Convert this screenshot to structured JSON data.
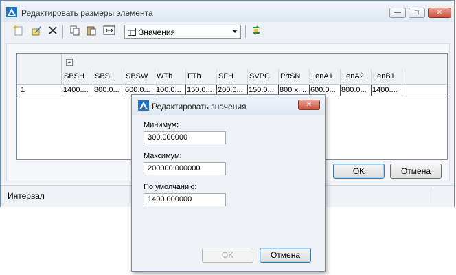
{
  "window": {
    "title": "Редактировать размеры элемента",
    "minimize_label": "—",
    "maximize_label": "□",
    "close_label": "✕"
  },
  "toolbar": {
    "combo_value": "Значения",
    "icons": [
      "new-row-icon",
      "edit-icon",
      "delete-icon",
      "copy-icon",
      "paste-icon",
      "insert-dimension-icon",
      "settings-table-icon",
      "refresh-icon"
    ]
  },
  "grid": {
    "expand_label": "+",
    "columns": [
      "SBSH",
      "SBSL",
      "SBSW",
      "WTh",
      "FTh",
      "SFH",
      "SVPC",
      "PrtSN",
      "LenA1",
      "LenA2",
      "LenB1"
    ],
    "rows": [
      {
        "num": "1",
        "cells": [
          "1400....",
          "800.0...",
          "600.0...",
          "100.0...",
          "150.0...",
          "200.0...",
          "150.0...",
          "800 x ...",
          "600.0...",
          "800.0...",
          "1400...."
        ]
      }
    ]
  },
  "buttons": {
    "ok": "OK",
    "cancel": "Отмена"
  },
  "status": {
    "text": "Интервал"
  },
  "dialog": {
    "title": "Редактировать значения",
    "close_label": "✕",
    "min_label": "Минимум:",
    "min_value": "300.000000",
    "max_label": "Максимум:",
    "max_value": "200000.000000",
    "default_label": "По умолчанию:",
    "default_value": "1400.000000",
    "ok": "OK",
    "cancel": "Отмена"
  },
  "colors": {
    "accent": "#3c7fb1",
    "close": "#c9523d",
    "window_bg": "#eef2f7"
  }
}
